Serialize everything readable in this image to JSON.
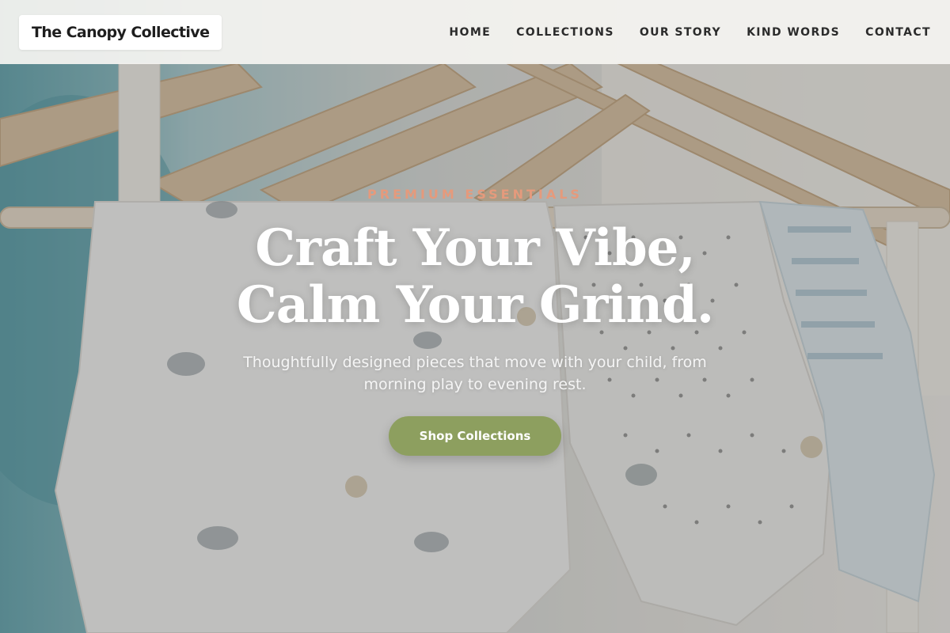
{
  "header": {
    "brand": "The Canopy Collective",
    "nav": [
      {
        "label": "HOME"
      },
      {
        "label": "COLLECTIONS"
      },
      {
        "label": "OUR STORY"
      },
      {
        "label": "KIND WORDS"
      },
      {
        "label": "CONTACT"
      }
    ]
  },
  "hero": {
    "eyebrow": "PREMIUM ESSENTIALS",
    "headline_line1": "Craft Your Vibe,",
    "headline_line2": "Calm Your Grind.",
    "subtitle": "Thoughtfully designed pieces that move with your child, from morning play to evening rest.",
    "cta_label": "Shop Collections"
  },
  "colors": {
    "eyebrow": "#e59a7c",
    "cta_background": "#8d9f5f",
    "header_background": "#f5f4f1"
  }
}
